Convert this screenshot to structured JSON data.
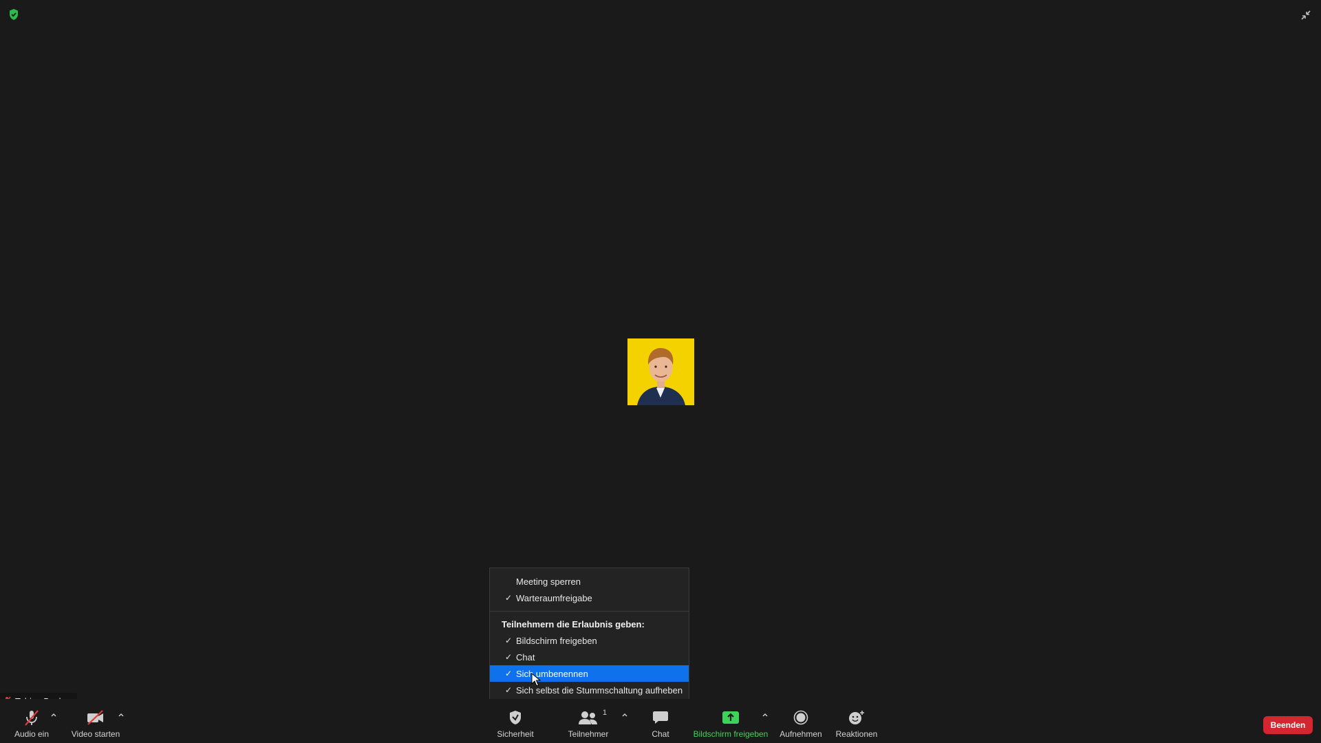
{
  "participant": {
    "name": "Tobias Becker"
  },
  "toolbar": {
    "audio_label": "Audio ein",
    "video_label": "Video starten",
    "security_label": "Sicherheit",
    "participants_label": "Teilnehmer",
    "participants_count": "1",
    "chat_label": "Chat",
    "share_label": "Bildschirm freigeben",
    "record_label": "Aufnehmen",
    "reactions_label": "Reaktionen",
    "end_label": "Beenden"
  },
  "security_menu": {
    "items_top": [
      {
        "label": "Meeting sperren",
        "checked": false
      },
      {
        "label": "Warteraumfreigabe",
        "checked": true
      }
    ],
    "heading": "Teilnehmern die Erlaubnis geben:",
    "items_permissions": [
      {
        "label": "Bildschirm freigeben",
        "checked": true
      },
      {
        "label": "Chat",
        "checked": true
      },
      {
        "label": "Sich umbenennen",
        "checked": true,
        "selected": true
      },
      {
        "label": "Sich selbst die Stummschaltung aufheben",
        "checked": true
      }
    ],
    "check_glyph": "✓"
  },
  "colors": {
    "background": "#1a1a1a",
    "accent_blue": "#0e72ed",
    "share_green": "#3fd25b",
    "end_red": "#d4262e",
    "avatar_bg": "#f4d200"
  },
  "icons": {
    "top_left": "shield-check-icon",
    "top_right": "exit-fullscreen-icon",
    "audio": "microphone-muted-icon",
    "video": "video-off-icon",
    "security": "shield-icon",
    "participants": "people-icon",
    "chat": "chat-bubble-icon",
    "share": "share-screen-icon",
    "record": "record-icon",
    "reactions": "emoji-add-icon"
  }
}
